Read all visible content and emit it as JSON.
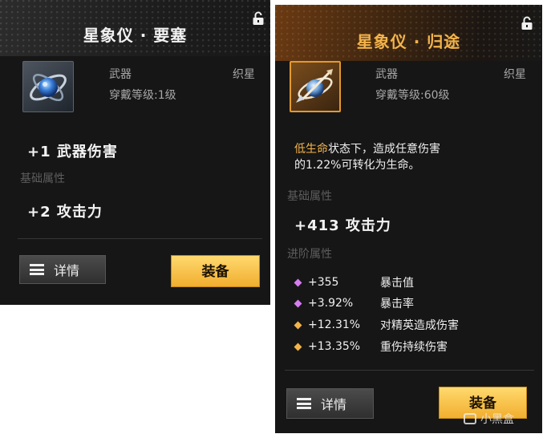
{
  "left_card": {
    "title": "星象仪 · 要塞",
    "type": "武器",
    "category": "织星",
    "level_req": "穿戴等级:1级",
    "main_effect": "+1 武器伤害",
    "base_attr_label": "基础属性",
    "base_attr_value": "+2 攻击力",
    "detail_btn": "详情",
    "equip_btn": "装备",
    "icon": "astrolabe-orb-icon"
  },
  "right_card": {
    "title": "星象仪 · 归途",
    "type": "武器",
    "category": "织星",
    "level_req": "穿戴等级:60级",
    "passive_hl": "低生命",
    "passive_rest1": "状态下，造成任意伤害",
    "passive_line2": "的1.22%可转化为生命。",
    "base_attr_label": "基础属性",
    "base_attr_value": "+413 攻击力",
    "adv_attr_label": "进阶属性",
    "adv_stats": [
      {
        "value": "+355",
        "name": "暴击值",
        "color": "#d77cf0"
      },
      {
        "value": "+3.92%",
        "name": "暴击率",
        "color": "#d77cf0"
      },
      {
        "value": "+12.31%",
        "name": "对精英造成伤害",
        "color": "#f4b44a"
      },
      {
        "value": "+13.35%",
        "name": "重伤持续伤害",
        "color": "#f4b44a"
      }
    ],
    "detail_btn": "详情",
    "equip_btn": "装备",
    "icon": "astrolabe-feather-icon"
  },
  "watermark": "小黑盒",
  "colors": {
    "accent_gold": "#f4b44a",
    "card_bg": "#161616",
    "equip_btn": "#f1ae2e"
  }
}
